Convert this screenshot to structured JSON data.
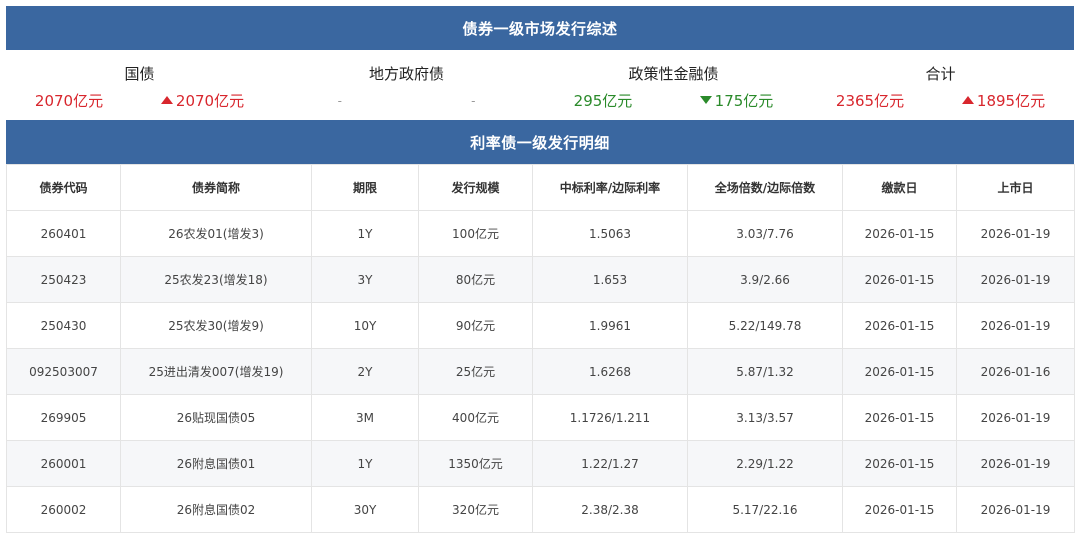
{
  "header": {
    "title": "债券一级市场发行综述"
  },
  "summary": [
    {
      "title": "国债",
      "value": "2070亿元",
      "change": "2070亿元",
      "change_dir": "up"
    },
    {
      "title": "地方政府债",
      "value": "-",
      "change": "-",
      "change_dir": "none"
    },
    {
      "title": "政策性金融债",
      "value": "295亿元",
      "change": "175亿元",
      "change_dir": "down"
    },
    {
      "title": "合计",
      "value": "2365亿元",
      "change": "1895亿元",
      "change_dir": "up"
    }
  ],
  "detail": {
    "title": "利率债一级发行明细",
    "columns": [
      "债券代码",
      "债券简称",
      "期限",
      "发行规模",
      "中标利率/边际利率",
      "全场倍数/边际倍数",
      "缴款日",
      "上市日"
    ],
    "rows": [
      [
        "260401",
        "26农发01(增发3)",
        "1Y",
        "100亿元",
        "1.5063",
        "3.03/7.76",
        "2026-01-15",
        "2026-01-19"
      ],
      [
        "250423",
        "25农发23(增发18)",
        "3Y",
        "80亿元",
        "1.653",
        "3.9/2.66",
        "2026-01-15",
        "2026-01-19"
      ],
      [
        "250430",
        "25农发30(增发9)",
        "10Y",
        "90亿元",
        "1.9961",
        "5.22/149.78",
        "2026-01-15",
        "2026-01-19"
      ],
      [
        "092503007",
        "25进出清发007(增发19)",
        "2Y",
        "25亿元",
        "1.6268",
        "5.87/1.32",
        "2026-01-15",
        "2026-01-16"
      ],
      [
        "269905",
        "26贴现国债05",
        "3M",
        "400亿元",
        "1.1726/1.211",
        "3.13/3.57",
        "2026-01-15",
        "2026-01-19"
      ],
      [
        "260001",
        "26附息国债01",
        "1Y",
        "1350亿元",
        "1.22/1.27",
        "2.29/1.22",
        "2026-01-15",
        "2026-01-19"
      ],
      [
        "260002",
        "26附息国债02",
        "30Y",
        "320亿元",
        "2.38/2.38",
        "5.17/22.16",
        "2026-01-15",
        "2026-01-19"
      ]
    ]
  },
  "colors": {
    "banner": "#3a67a0",
    "up": "#d8262d",
    "down": "#2a8a2a"
  }
}
